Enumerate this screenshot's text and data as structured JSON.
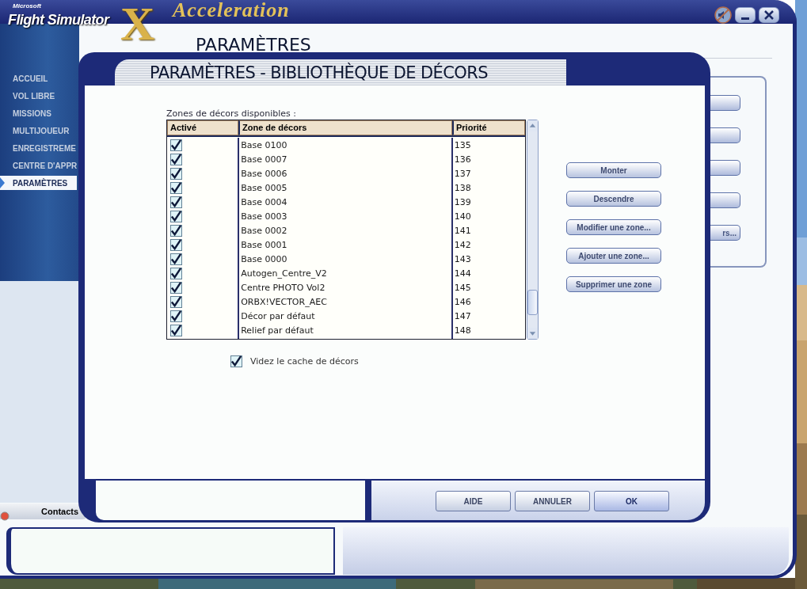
{
  "window": {
    "logo": {
      "brand": "Microsoft",
      "product": "Flight Simulator",
      "letter": "X",
      "edition": "Acceleration"
    },
    "title": "PARAMÈTRES",
    "sound_muted": true
  },
  "nav": [
    {
      "label": "ACCUEIL",
      "selected": false
    },
    {
      "label": "VOL LIBRE",
      "selected": false
    },
    {
      "label": "MISSIONS",
      "selected": false
    },
    {
      "label": "MULTIJOUEUR",
      "selected": false
    },
    {
      "label": "ENREGISTREME",
      "selected": false
    },
    {
      "label": "CENTRE D'APPR",
      "selected": false
    },
    {
      "label": "PARAMÈTRES",
      "selected": true
    }
  ],
  "background_panel": {
    "last_button_label": "rs..."
  },
  "contacts": {
    "label": "Contacts"
  },
  "dialog": {
    "title": "PARAMÈTRES - BIBLIOTHÈQUE DE DÉCORS",
    "list_label": "Zones de décors disponibles :",
    "columns": [
      "Activé",
      "Zone de décors",
      "Priorité"
    ],
    "rows": [
      {
        "checked": true,
        "zone": "Base 0100",
        "priority": "135"
      },
      {
        "checked": true,
        "zone": "Base 0007",
        "priority": "136"
      },
      {
        "checked": true,
        "zone": "Base 0006",
        "priority": "137"
      },
      {
        "checked": true,
        "zone": "Base 0005",
        "priority": "138"
      },
      {
        "checked": true,
        "zone": "Base 0004",
        "priority": "139"
      },
      {
        "checked": true,
        "zone": "Base 0003",
        "priority": "140"
      },
      {
        "checked": true,
        "zone": "Base 0002",
        "priority": "141"
      },
      {
        "checked": true,
        "zone": "Base 0001",
        "priority": "142"
      },
      {
        "checked": true,
        "zone": "Base 0000",
        "priority": "143"
      },
      {
        "checked": true,
        "zone": "Autogen_Centre_V2",
        "priority": "144"
      },
      {
        "checked": true,
        "zone": "Centre PHOTO Vol2",
        "priority": "145"
      },
      {
        "checked": true,
        "zone": "ORBX!VECTOR_AEC",
        "priority": "146"
      },
      {
        "checked": true,
        "zone": "Décor par défaut",
        "priority": "147"
      },
      {
        "checked": true,
        "zone": "Relief par défaut",
        "priority": "148"
      }
    ],
    "actions": [
      "Monter",
      "Descendre",
      "Modifier une zone...",
      "Ajouter une zone...",
      "Supprimer une zone"
    ],
    "clear_cache": {
      "label": "Videz le cache de décors",
      "checked": true
    },
    "buttons": [
      {
        "label": "AIDE",
        "default": false
      },
      {
        "label": "ANNULER",
        "default": false
      },
      {
        "label": "OK",
        "default": true
      }
    ]
  }
}
